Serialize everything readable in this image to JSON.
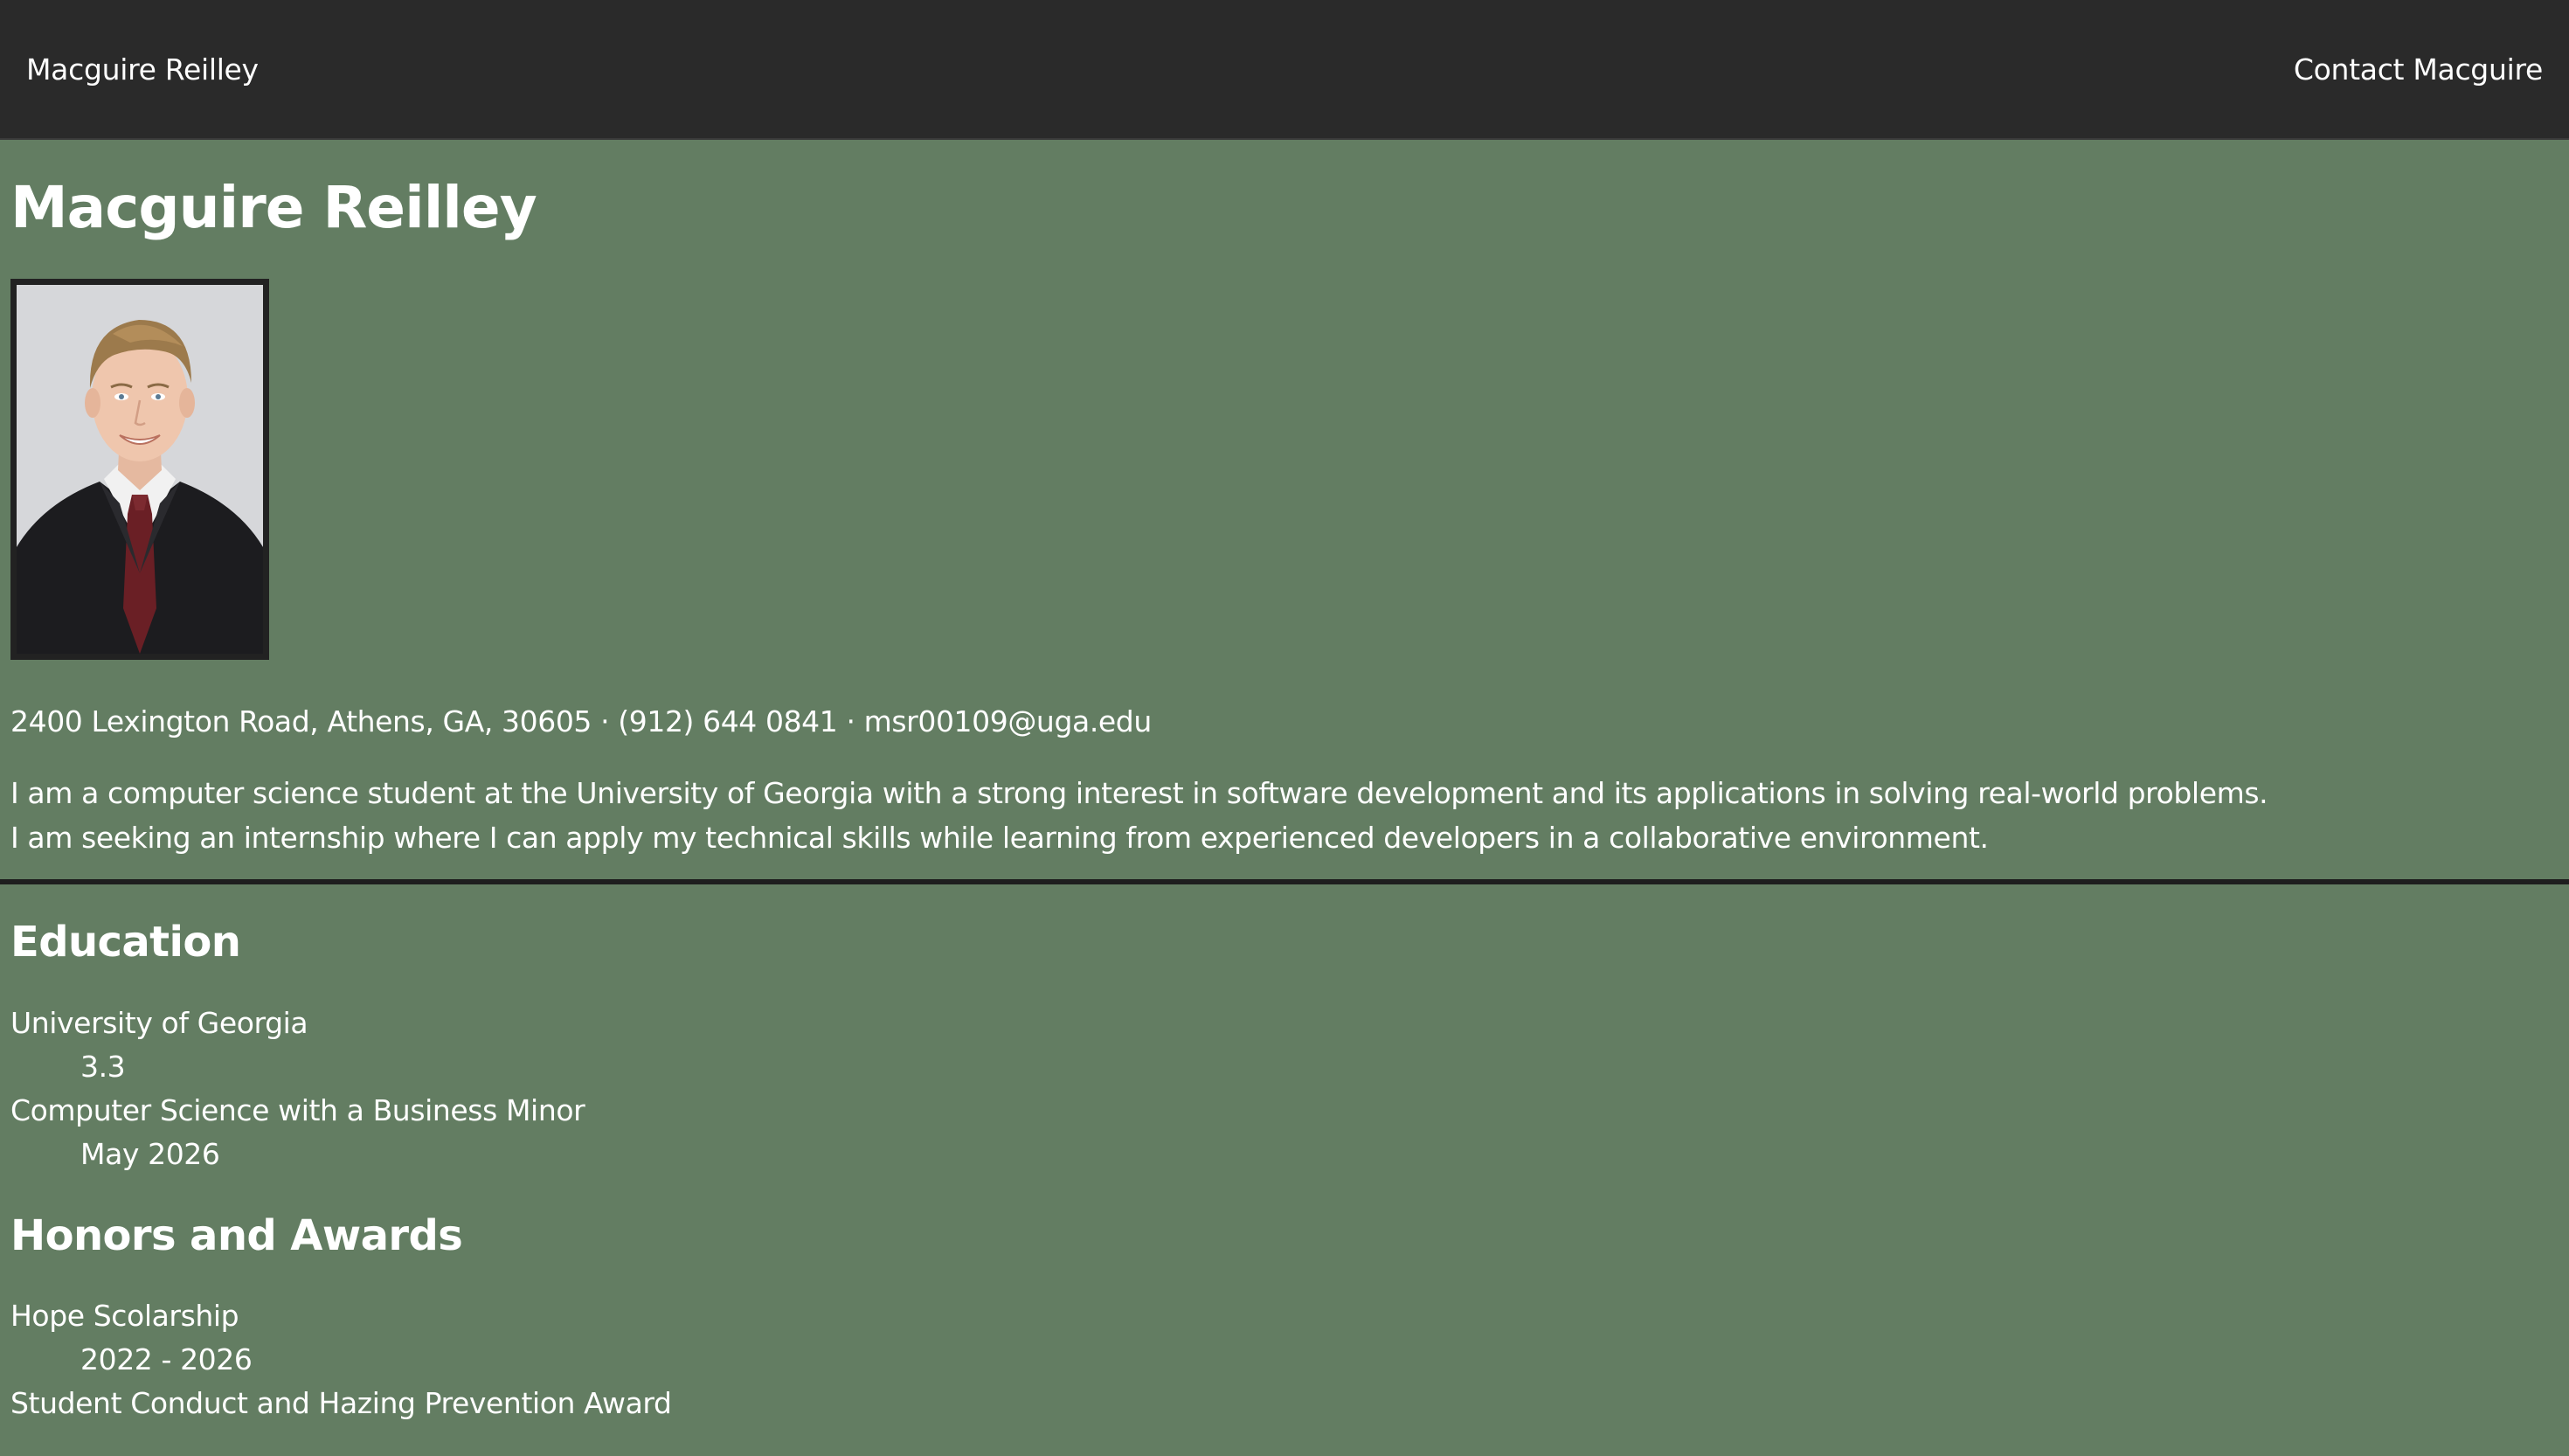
{
  "nav": {
    "brand": "Macguire Reilley",
    "contact_link": "Contact Macguire"
  },
  "header": {
    "title": "Macguire Reilley"
  },
  "profile": {
    "contact_line": "2400 Lexington Road, Athens, GA, 30605 · (912) 644 0841 · msr00109@uga.edu",
    "summary": [
      "I am a computer science student at the University of Georgia with a strong interest in software development and its applications in solving real-world problems.",
      "I am seeking an internship where I can apply my technical skills while learning from experienced developers in a collaborative environment."
    ]
  },
  "education": {
    "heading": "Education",
    "entries": [
      {
        "main": "University of Georgia",
        "sub": "3.3"
      },
      {
        "main": "Computer Science with a Business Minor",
        "sub": "May 2026"
      }
    ]
  },
  "honors": {
    "heading": "Honors and Awards",
    "entries": [
      {
        "main": "Hope Scolarship",
        "sub": "2022 - 2026"
      },
      {
        "main": "Student Conduct and Hazing Prevention Award",
        "sub": ""
      }
    ]
  },
  "colors": {
    "page_background": "#637d62",
    "navbar_background": "#2a2a2a",
    "text": "#ffffff",
    "divider": "#1e1e1e"
  }
}
